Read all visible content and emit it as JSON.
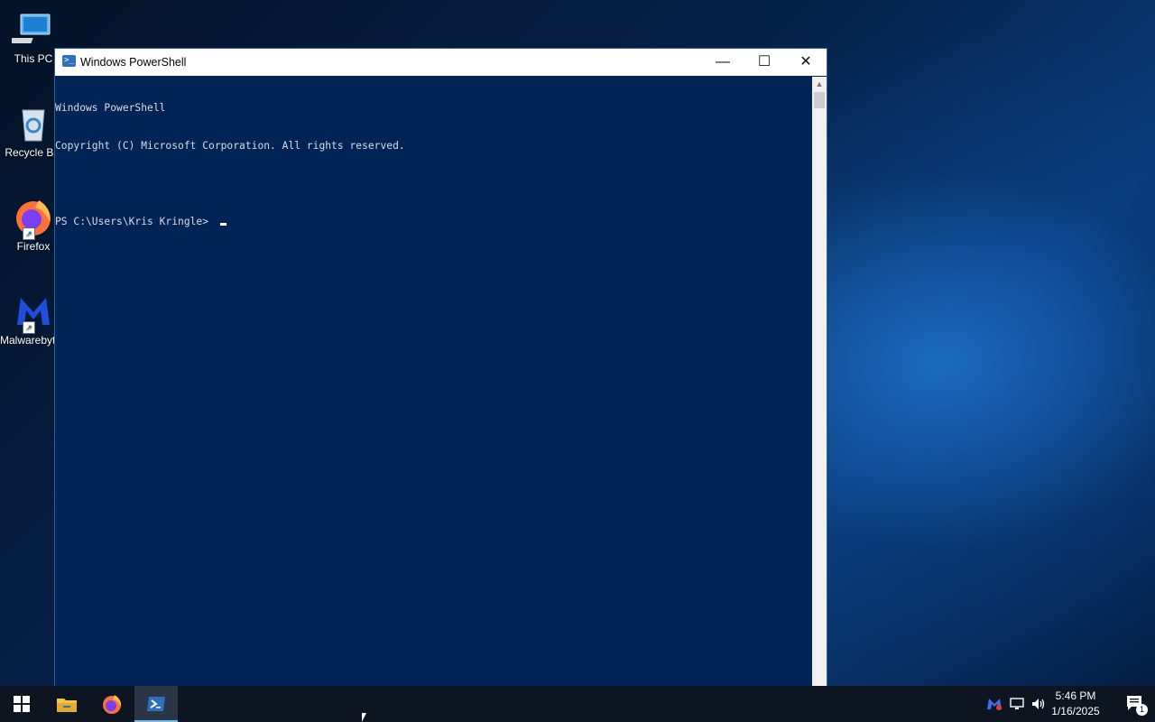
{
  "desktop": {
    "icons": [
      {
        "label": "This PC"
      },
      {
        "label": "Recycle Bin"
      },
      {
        "label": "Firefox"
      },
      {
        "label": "Malwarebytes"
      }
    ]
  },
  "window": {
    "title": "Windows PowerShell",
    "buttons": {
      "minimize": "—",
      "maximize": "☐",
      "close": "✕"
    },
    "console_lines": [
      "Windows PowerShell",
      "Copyright (C) Microsoft Corporation. All rights reserved.",
      "",
      "PS C:\\Users\\Kris Kringle> "
    ]
  },
  "taskbar": {
    "items": [
      "start",
      "file-explorer",
      "firefox",
      "powershell"
    ],
    "clock_time": "5:46 PM",
    "clock_date": "1/16/2025",
    "notification_count": "1"
  },
  "colors": {
    "console_bg": "#012456",
    "taskbar_bg": "#0d1521",
    "accent": "#76b9ed"
  }
}
